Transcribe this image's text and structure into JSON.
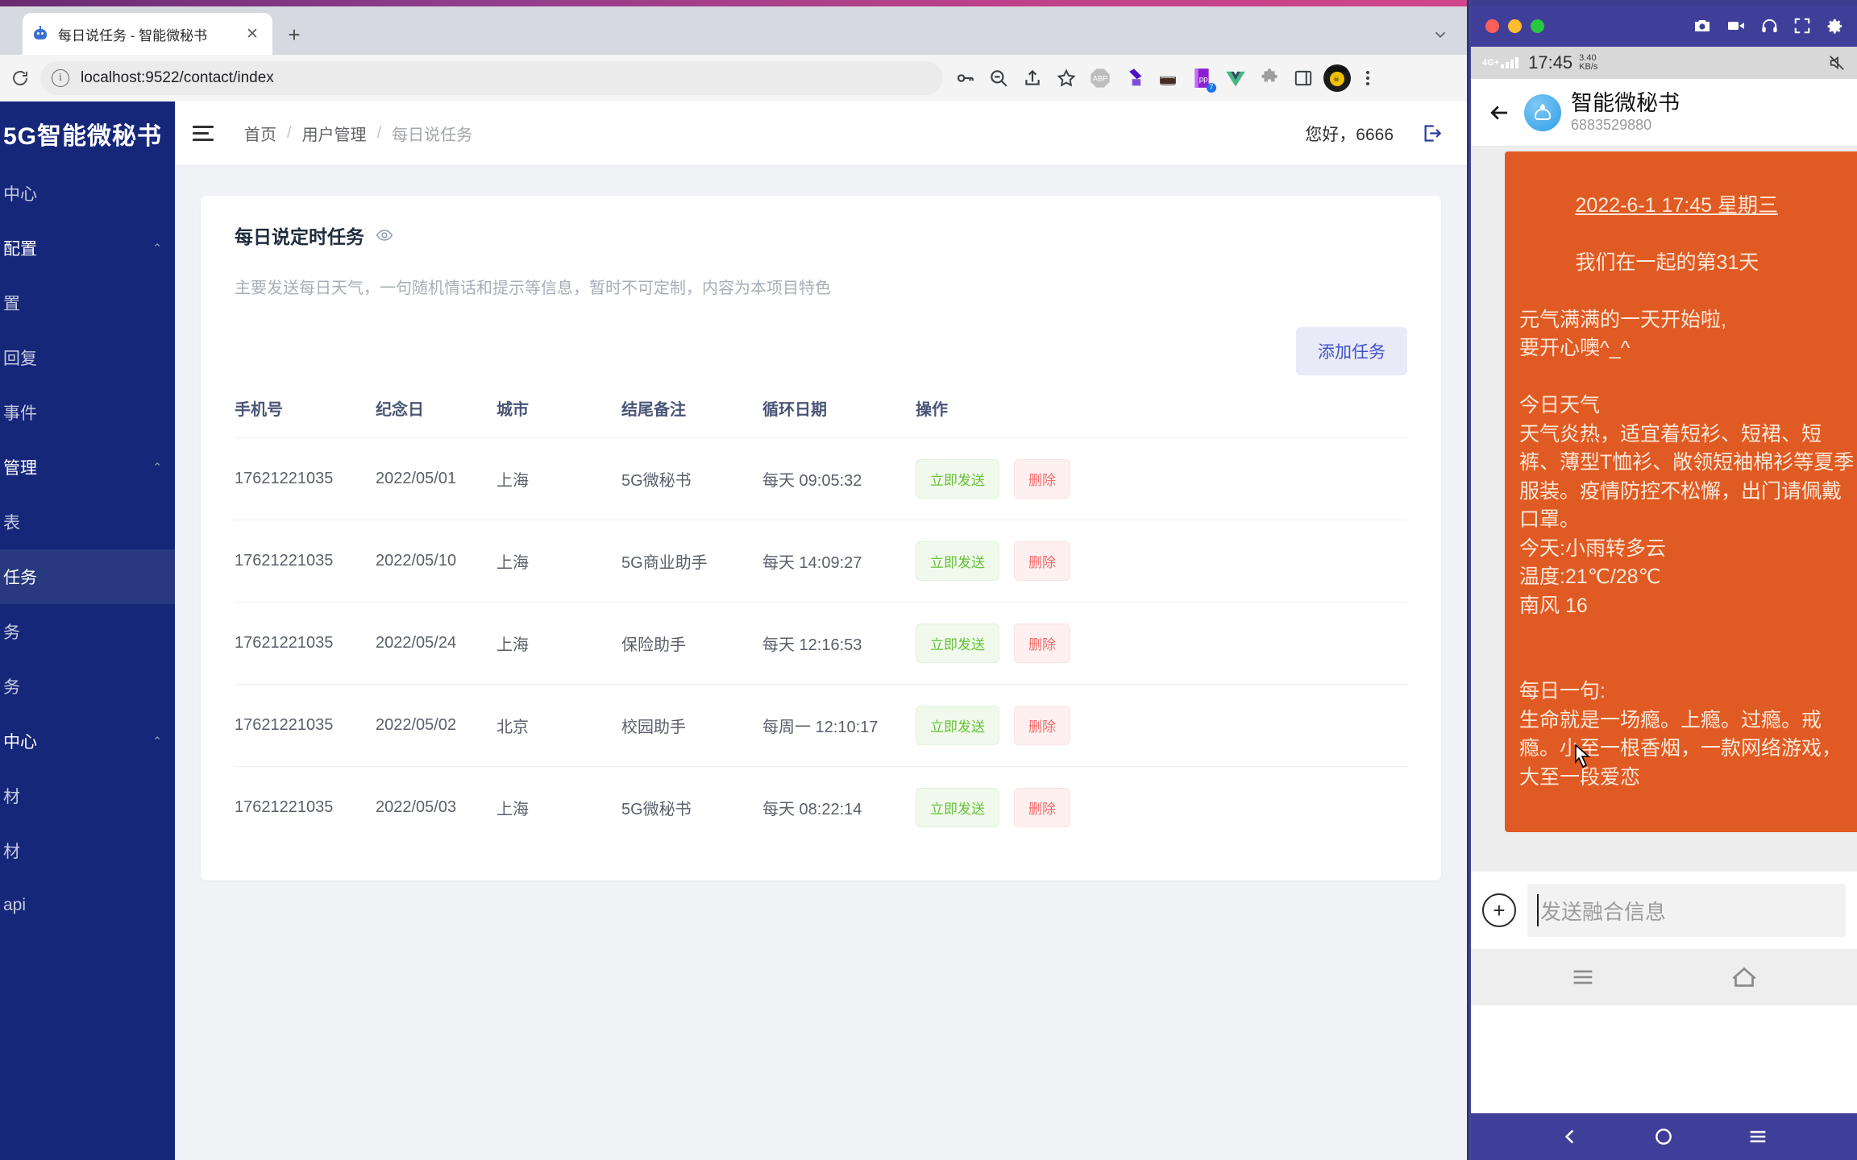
{
  "browser": {
    "tab": {
      "title": "每日说任务 - 智能微秘书",
      "favicon": "robot-icon",
      "close_label": "✕"
    },
    "new_tab_label": "+",
    "omnibox": {
      "url": "localhost:9522/contact/index",
      "info_icon": "ⓘ"
    },
    "toolbar_icons": [
      "key-icon",
      "zoom-out-icon",
      "share-icon",
      "star-icon",
      "adblock-plus-icon",
      "extension-purple-icon",
      "incognito-mask-icon",
      "pp-book-icon",
      "vue-devtools-icon",
      "puzzle-extensions-icon",
      "side-panel-icon",
      "profile-avatar-icon"
    ],
    "extension_badge_count": "7"
  },
  "sidebar": {
    "logo": "5G智能微秘书",
    "items": [
      {
        "label": "中心",
        "type": "item",
        "active": false,
        "arrow": ""
      },
      {
        "label": "配置",
        "type": "group",
        "active": false,
        "arrow": "⌃"
      },
      {
        "label": "置",
        "type": "item",
        "active": false,
        "arrow": ""
      },
      {
        "label": "回复",
        "type": "item",
        "active": false,
        "arrow": ""
      },
      {
        "label": "事件",
        "type": "item",
        "active": false,
        "arrow": ""
      },
      {
        "label": "管理",
        "type": "group",
        "active": false,
        "arrow": "⌃"
      },
      {
        "label": "表",
        "type": "item",
        "active": false,
        "arrow": ""
      },
      {
        "label": "任务",
        "type": "item",
        "active": true,
        "arrow": ""
      },
      {
        "label": "务",
        "type": "item",
        "active": false,
        "arrow": ""
      },
      {
        "label": "务",
        "type": "item",
        "active": false,
        "arrow": ""
      },
      {
        "label": "中心",
        "type": "group",
        "active": false,
        "arrow": "⌃"
      },
      {
        "label": "材",
        "type": "item",
        "active": false,
        "arrow": ""
      },
      {
        "label": "材",
        "type": "item",
        "active": false,
        "arrow": ""
      },
      {
        "label": "api",
        "type": "item",
        "active": false,
        "arrow": ""
      }
    ]
  },
  "topbar": {
    "menu_icon": "hamburger-icon",
    "breadcrumbs": [
      "首页",
      "用户管理",
      "每日说任务"
    ],
    "separator": "/",
    "greeting": "您好，6666",
    "logout_icon": "logout-icon"
  },
  "card": {
    "title": "每日说定时任务",
    "title_icon": "eye-icon",
    "description": "主要发送每日天气，一句随机情话和提示等信息，暂时不可定制，内容为本项目特色",
    "add_button": "添加任务"
  },
  "table": {
    "headers": [
      "手机号",
      "纪念日",
      "城市",
      "结尾备注",
      "循环日期",
      "操作"
    ],
    "send_label": "立即发送",
    "delete_label": "删除",
    "rows": [
      {
        "phone": "17621221035",
        "anniversary": "2022/05/01",
        "city": "上海",
        "note": "5G微秘书",
        "cycle": "每天 09:05:32"
      },
      {
        "phone": "17621221035",
        "anniversary": "2022/05/10",
        "city": "上海",
        "note": "5G商业助手",
        "cycle": "每天 14:09:27"
      },
      {
        "phone": "17621221035",
        "anniversary": "2022/05/24",
        "city": "上海",
        "note": "保险助手",
        "cycle": "每天 12:16:53"
      },
      {
        "phone": "17621221035",
        "anniversary": "2022/05/02",
        "city": "北京",
        "note": "校园助手",
        "cycle": "每周一 12:10:17"
      },
      {
        "phone": "17621221035",
        "anniversary": "2022/05/03",
        "city": "上海",
        "note": "5G微秘书",
        "cycle": "每天 08:22:14"
      }
    ]
  },
  "mirror": {
    "window_buttons": [
      "close-red",
      "minimize-yellow",
      "maximize-green"
    ],
    "tool_icons": [
      "camera-icon",
      "video-icon",
      "headphone-icon",
      "fullscreen-icon",
      "gear-icon"
    ],
    "status_bar": {
      "network": "4G+",
      "time": "17:45",
      "speed_value": "3.40",
      "speed_unit": "KB/s",
      "right_icon": "mute-icon"
    },
    "chat_header": {
      "back_icon": "back-arrow-icon",
      "avatar_icon": "robot-avatar-icon",
      "title": "智能微秘书",
      "subtitle": "6883529880"
    },
    "message": {
      "date_line": "2022-6-1 17:45 星期三",
      "body": "我们在一起的第31天\n\n元气满满的一天开始啦,\n要开心噢^_^\n\n今日天气\n天气炎热，适宜着短衫、短裙、短裤、薄型T恤衫、敞领短袖棉衫等夏季服装。疫情防控不松懈，出门请佩戴口罩。\n今天:小雨转多云\n温度:21℃/28℃\n南风 16\n\n\n每日一句:\n生命就是一场瘾。上瘾。过瘾。戒瘾。小至一根香烟，一款网络游戏，大至一段爱恋"
    },
    "input_bar": {
      "plus_icon": "plus-icon",
      "placeholder": "发送融合信息"
    },
    "soft_nav": [
      "menu-icon",
      "home-icon"
    ],
    "system_nav": [
      "back-icon",
      "home-circle-icon",
      "recents-icon"
    ]
  }
}
